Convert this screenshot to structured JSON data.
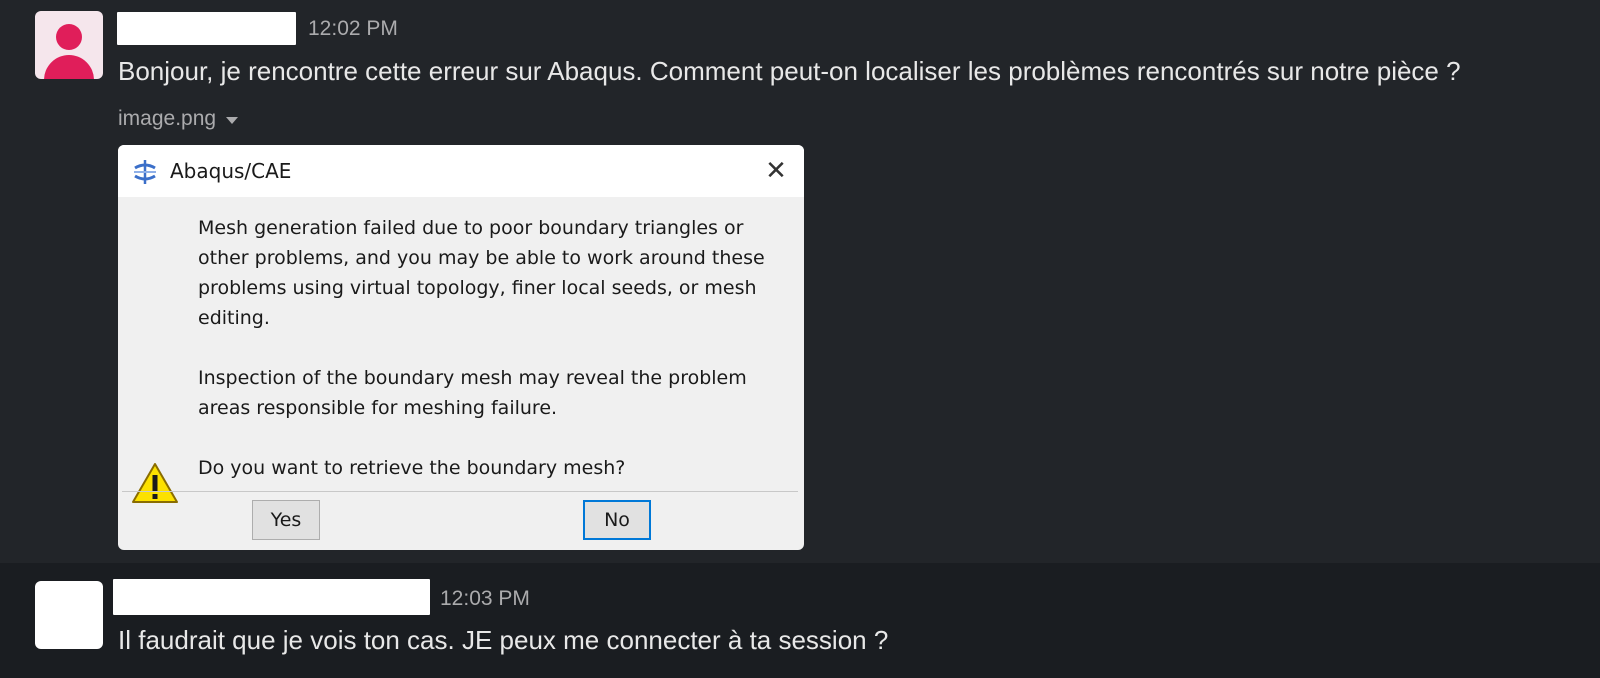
{
  "messages": [
    {
      "time": "12:02 PM",
      "text": "Bonjour, je rencontre cette erreur sur Abaqus. Comment peut-on localiser les problèmes rencontrés sur notre pièce ?",
      "attachment": {
        "filename": "image.png",
        "dialog": {
          "title": "Abaqus/CAE",
          "paragraphs": [
            "Mesh generation failed due to poor boundary triangles or other problems, and you may be able to work around these problems using virtual topology, finer local seeds, or mesh editing.",
            "Inspection of the boundary mesh may reveal the problem areas responsible for meshing failure.",
            "Do you want to retrieve the boundary mesh?"
          ],
          "buttons": {
            "yes": "Yes",
            "no": "No"
          },
          "icons": {
            "app": "abaqus-icon",
            "warning": "warning-icon",
            "close": "close-icon"
          }
        }
      }
    },
    {
      "time": "12:03 PM",
      "text": "Il faudrait que je vois ton cas. JE peux me connecter à ta session ?"
    }
  ],
  "colors": {
    "background": "#222529",
    "highlight_row": "#1a1d21",
    "avatar_accent": "#e01e5a",
    "focus_border": "#0078d7"
  }
}
